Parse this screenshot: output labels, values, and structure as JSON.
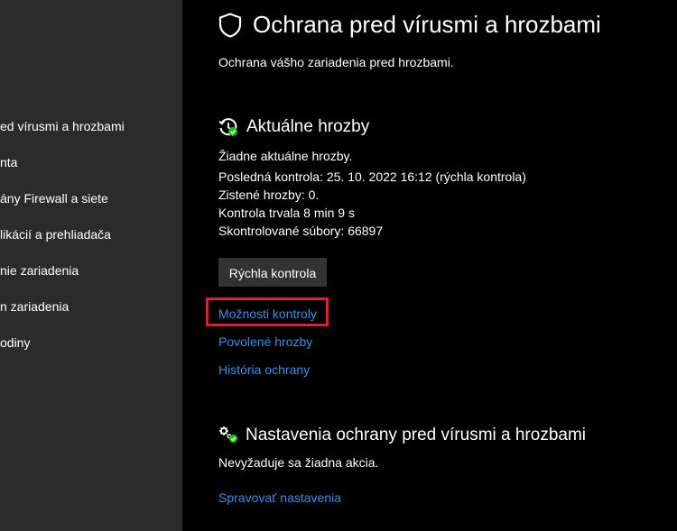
{
  "sidebar": {
    "items": [
      {
        "label": "ed vírusmi a hrozbami"
      },
      {
        "label": "nta"
      },
      {
        "label": "ány Firewall a siete"
      },
      {
        "label": "likácií a prehliadača"
      },
      {
        "label": "nie zariadenia"
      },
      {
        "label": "n zariadenia"
      },
      {
        "label": "odiny"
      }
    ]
  },
  "header": {
    "title": "Ochrana pred vírusmi a hrozbami",
    "subtitle": "Ochrana vášho zariadenia pred hrozbami.",
    "icon": "shield-icon"
  },
  "current_threats": {
    "title": "Aktuálne hrozby",
    "icon": "history-check-icon",
    "lines": [
      "Žiadne aktuálne hrozby.",
      "Posledná kontrola: 25. 10. 2022 16:12 (rýchla kontrola)",
      "Zistené hrozby: 0.",
      "Kontrola trvala 8 min 9 s",
      "Skontrolované súbory: 66897"
    ],
    "quick_scan_label": "Rýchla kontrola",
    "links": {
      "scan_options": "Možnosti kontroly",
      "allowed_threats": "Povolené hrozby",
      "protection_history": "História ochrany"
    }
  },
  "settings": {
    "title": "Nastavenia ochrany pred vírusmi a hrozbami",
    "icon": "gears-check-icon",
    "status": "Nevyžaduje sa žiadna akcia.",
    "manage_link": "Spravovať nastavenia"
  },
  "colors": {
    "sidebar_bg": "#2b2b2b",
    "main_bg": "#000000",
    "link": "#3b8ee8",
    "button_bg": "#333333",
    "highlight": "#e0202b",
    "status_green": "#16c60c"
  }
}
